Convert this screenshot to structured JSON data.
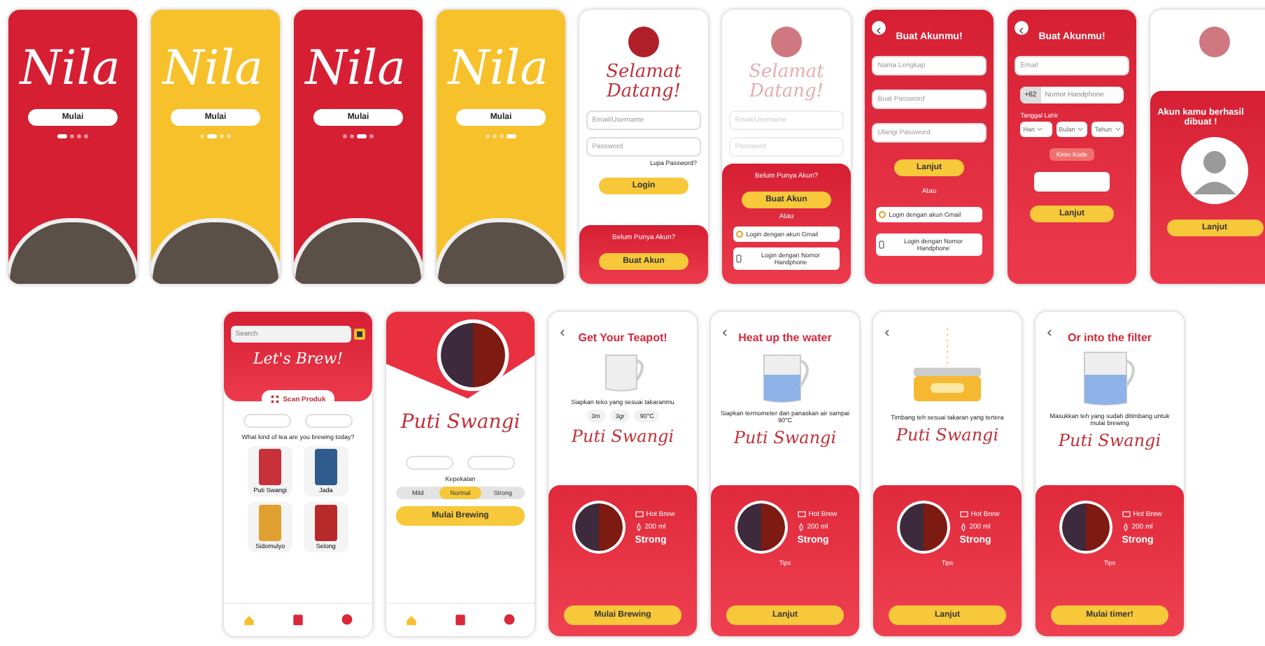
{
  "top_screens": [
    {
      "kind": "splash",
      "color": "#d61f33",
      "logo": "Nila",
      "button": "Mulai",
      "page_dots": [
        {
          "selected": true
        },
        {
          "selected": false
        },
        {
          "selected": false
        },
        {
          "selected": false
        }
      ]
    },
    {
      "kind": "splash",
      "color": "#f6c12a",
      "logo": "Nila",
      "button": "Mulai",
      "page_dots": [
        {
          "selected": false
        },
        {
          "selected": true
        },
        {
          "selected": false
        },
        {
          "selected": false
        }
      ]
    },
    {
      "kind": "splash",
      "color": "#d61f33",
      "logo": "Nila",
      "button": "Mulai",
      "page_dots": [
        {
          "selected": false
        },
        {
          "selected": false
        },
        {
          "selected": true
        },
        {
          "selected": false
        }
      ]
    },
    {
      "kind": "splash",
      "color": "#f6c12a",
      "logo": "Nila",
      "button": "Mulai",
      "page_dots": [
        {
          "selected": false
        },
        {
          "selected": false
        },
        {
          "selected": false
        },
        {
          "selected": true
        }
      ]
    },
    {
      "kind": "login",
      "title": "Selamat Datang!",
      "fields": [
        {
          "placeholder": "Email/Username"
        },
        {
          "placeholder": "Password"
        }
      ],
      "link": "Lupa Password?",
      "button": "Login",
      "sheet": {
        "title": "Belum Punya Akun?",
        "button": "Buat Akun"
      }
    },
    {
      "kind": "login_sheet",
      "title": "Selamat Datang!",
      "fields": [
        {
          "placeholder": "Email/Username"
        },
        {
          "placeholder": "Password"
        }
      ],
      "sheet": {
        "title": "Belum Punya Akun?",
        "button": "Buat Akun",
        "divider": "Atau",
        "options": [
          "Login dengan akun Gmail",
          "Login dengan Nomor Handphone"
        ]
      }
    },
    {
      "kind": "register",
      "title": "Buat Akunmu!",
      "fields": [
        {
          "placeholder": "Nama Lengkap"
        },
        {
          "placeholder": "Buat Password"
        },
        {
          "placeholder": "Ulangi Password"
        }
      ],
      "button": "Lanjut",
      "divider": "Atau",
      "options": [
        "Login dengan akun Gmail",
        "Login dengan Nomor Handphone"
      ]
    },
    {
      "kind": "register_phone",
      "title": "Buat Akunmu!",
      "fields": [
        {
          "placeholder": "Email"
        }
      ],
      "country_code": "+62",
      "phone_placeholder": "Nomor Handphone",
      "date_label": "Tanggal Lahir",
      "selects": [
        "Hari",
        "Bulan",
        "Tahun"
      ],
      "send_code": "Kirim Kode",
      "button": "Lanjut"
    },
    {
      "kind": "success",
      "title": "Akun kamu berhasil dibuat !",
      "button": "Lanjut"
    }
  ],
  "bottom_screens": [
    {
      "kind": "home",
      "search": {
        "placeholder": "Search"
      },
      "heading": "Let's Brew!",
      "scan": "Scan Produk",
      "question": "What kind of tea are you brewing today?",
      "products": [
        {
          "name": "Puti Swangi",
          "color": "#c8303a"
        },
        {
          "name": "Jada",
          "color": "#2f5c8c"
        },
        {
          "name": "Sidomulyo",
          "color": "#e0a030"
        },
        {
          "name": "Selong",
          "color": "#b82a2a"
        }
      ],
      "nav": [
        {
          "selected": true
        },
        {
          "selected": false
        },
        {
          "selected": false
        }
      ]
    },
    {
      "kind": "detail",
      "name": "Puti Swangi",
      "strength_label": "Kepekatan",
      "options": [
        {
          "label": "Mild",
          "selected": false
        },
        {
          "label": "Normal",
          "selected": true
        },
        {
          "label": "Strong",
          "selected": false
        }
      ],
      "button": "Mulai Brewing",
      "nav": [
        {
          "selected": true
        },
        {
          "selected": false
        },
        {
          "selected": false
        }
      ]
    },
    {
      "kind": "step",
      "title": "Get Your Teapot!",
      "illustration": {
        "kind": "teapot"
      },
      "instruction": "Siapkan teko yang sesuai takaranmu",
      "chips": [
        "3m",
        "3gr",
        "90°C"
      ],
      "name": "Puti Swangi",
      "card": {
        "method": "Hot Brew",
        "volume": "200 ml",
        "strength": "Strong"
      },
      "button": "Mulai Brewing"
    },
    {
      "kind": "step",
      "title": "Heat up the water",
      "illustration": {
        "kind": "kettle"
      },
      "instruction": "Siapkan termometer dan panaskan air sampai 90°C",
      "name": "Puti Swangi",
      "card": {
        "method": "Hot Brew",
        "volume": "200 ml",
        "strength": "Strong"
      },
      "tip_title": "Tips",
      "button": "Lanjut"
    },
    {
      "kind": "step",
      "illustration": {
        "kind": "scale"
      },
      "instruction": "Timbang teh sesuai takaran yang tertera",
      "name": "Puti Swangi",
      "card": {
        "method": "Hot Brew",
        "volume": "200 ml",
        "strength": "Strong"
      },
      "tip_title": "Tips",
      "button": "Lanjut"
    },
    {
      "kind": "step",
      "title": "Or into the filter",
      "illustration": {
        "kind": "filter"
      },
      "instruction": "Masukkan teh yang sudah ditimbang untuk mulai brewing",
      "name": "Puti Swangi",
      "card": {
        "method": "Hot Brew",
        "volume": "200 ml",
        "strength": "Strong"
      },
      "tip_title": "Tips",
      "button": "Mulai timer!"
    }
  ]
}
